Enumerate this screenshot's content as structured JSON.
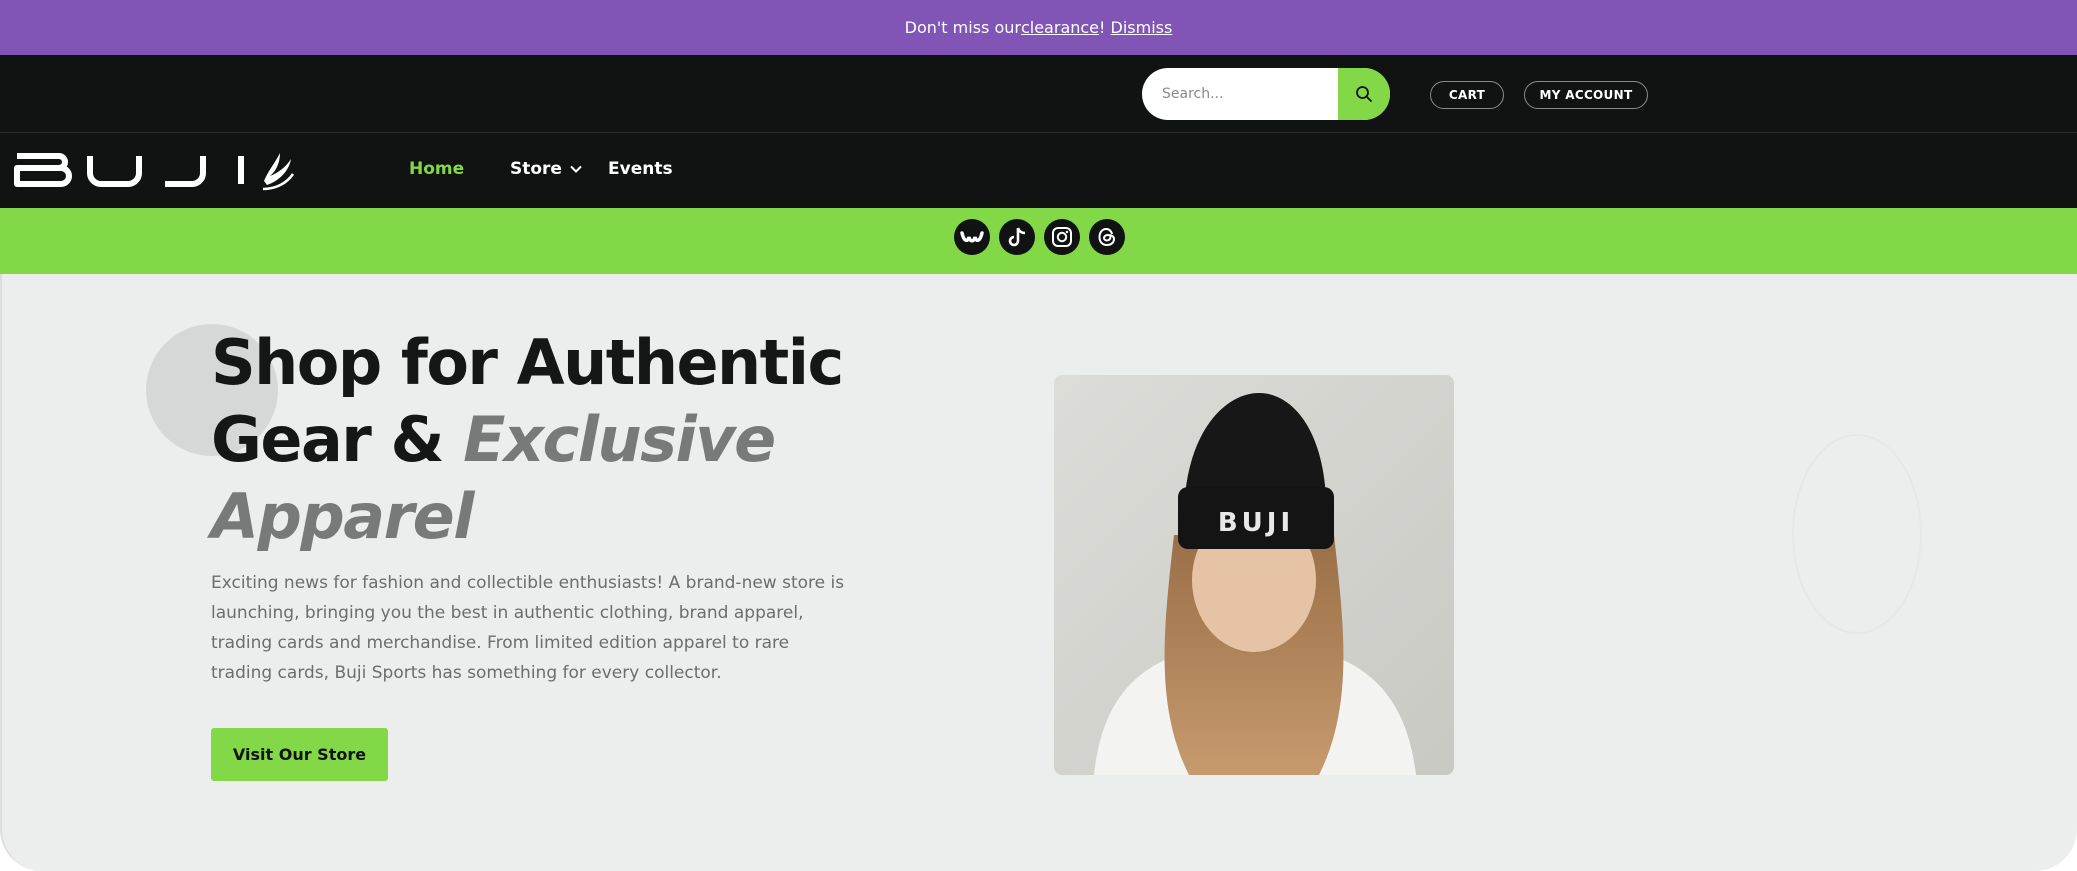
{
  "announcement": {
    "prefix": "Don't miss our ",
    "link": "clearance",
    "suffix": "! ",
    "dismiss": "Dismiss"
  },
  "search": {
    "placeholder": "Search..."
  },
  "account_links": {
    "cart": "CART",
    "account": "MY ACCOUNT"
  },
  "brand": {
    "name": "BUJI"
  },
  "nav": {
    "home": "Home",
    "store": "Store",
    "events": "Events"
  },
  "social": [
    "wonder-icon",
    "tiktok-icon",
    "instagram-icon",
    "threads-icon"
  ],
  "hero": {
    "title_line1": "Shop for Authentic",
    "title_line2_plain": "Gear & ",
    "title_line2_emph": "Exclusive",
    "title_line3_emph": "Apparel",
    "description": "Exciting news for fashion and collectible enthusiasts! A brand-new store is launching, bringing you the best in authentic clothing, brand apparel, trading cards and merchandise. From limited edition apparel to rare trading cards, Buji Sports has something for every collector.",
    "cta": "Visit Our Store",
    "image_text": "BUJI"
  },
  "colors": {
    "purple": "#8155b5",
    "dark": "#111312",
    "green": "#82d846",
    "hero_bg": "#eceeed"
  }
}
